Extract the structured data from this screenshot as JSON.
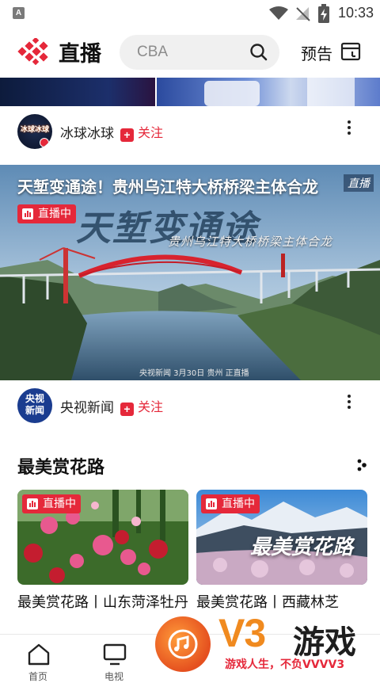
{
  "status_bar": {
    "time": "10:33",
    "a_icon": "A"
  },
  "header": {
    "title": "直播",
    "search_placeholder": "CBA",
    "preview_label": "预告"
  },
  "channel1": {
    "name": "冰球冰球",
    "follow_label": "关注",
    "avatar_text": "冰球冰球"
  },
  "hero": {
    "title": "天堑变通途！贵州乌江特大桥桥梁主体合龙",
    "live_label": "直播中",
    "calligraphy": "天堑变通途",
    "subtitle": "贵州乌江特大桥桥梁主体合龙",
    "brand": "直播",
    "caption": "央视新闻 3月30日 贵州 正直播"
  },
  "channel2": {
    "name": "央视新闻",
    "follow_label": "关注",
    "avatar_text": "央视新闻"
  },
  "section": {
    "title": "最美赏花路",
    "cards": [
      {
        "live_label": "直播中",
        "title": "最美赏花路丨山东菏泽牡丹"
      },
      {
        "live_label": "直播中",
        "title": "最美赏花路丨西藏林芝",
        "overlay": "最美赏花路"
      }
    ]
  },
  "bottom_nav": {
    "items": [
      "首页",
      "电视"
    ]
  },
  "watermark": {
    "brand": "V3",
    "name": "游戏",
    "slogan": "游戏人生，不负VVVV3"
  },
  "colors": {
    "accent": "#e5283a",
    "watermark_orange": "#f08a1f"
  }
}
